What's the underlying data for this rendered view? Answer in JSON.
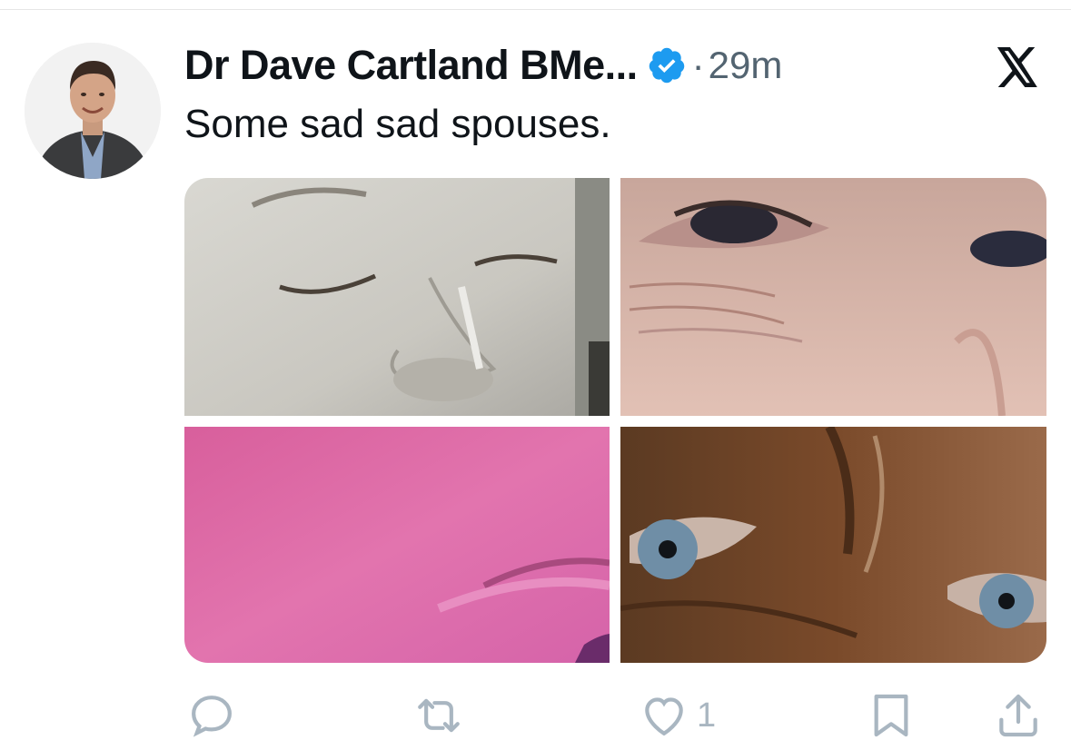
{
  "tweet": {
    "author_name": "Dr Dave Cartland BMe...",
    "separator": "·",
    "time_ago": "29m",
    "text": "Some sad sad spouses.",
    "verified": true,
    "like_count": "1"
  },
  "icons": {
    "verified": "verified-badge-icon",
    "close": "x-logo-icon",
    "reply": "reply-icon",
    "retweet": "retweet-icon",
    "like": "heart-icon",
    "bookmark": "bookmark-icon",
    "share": "share-icon"
  },
  "colors": {
    "text_primary": "#0f1419",
    "text_secondary": "#536471",
    "verified_blue": "#1d9bf0",
    "action_gray": "#a9b6c1"
  }
}
